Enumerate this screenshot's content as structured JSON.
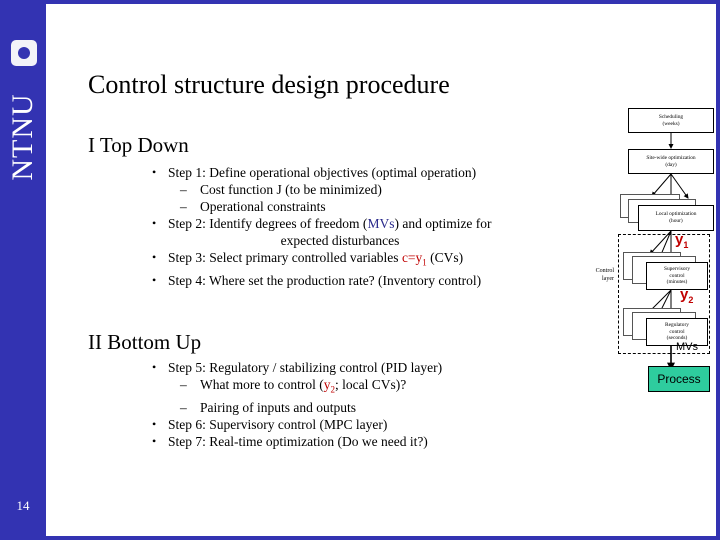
{
  "sidebar": {
    "brand": "NTNU",
    "logo_icon": "ntnu-square-dot-logo",
    "page_number": "14"
  },
  "slide": {
    "title": "Control structure design procedure",
    "accent_color": "#3333b2",
    "highlight_red": "#c00000",
    "highlight_blue": "#2a2a8c"
  },
  "sections": {
    "top_down": {
      "heading": "I  Top Down",
      "bullets": [
        {
          "level": 1,
          "prefix": "Step 1: Define operational objectives (optimal operation)"
        },
        {
          "level": 2,
          "prefix": "Cost function J (to be minimized)"
        },
        {
          "level": 2,
          "prefix": "Operational constraints"
        },
        {
          "level": 1,
          "prefix": "Step 2: Identify degrees of freedom (",
          "mark": "MVs",
          "mark_color": "blue",
          "suffix": ") and optimize for"
        },
        {
          "level": 1,
          "center": true,
          "prefix": "expected disturbances"
        },
        {
          "level": 1,
          "prefix": "Step 3: Select primary controlled variables ",
          "mark": "c=y",
          "mark_sub": "1",
          "mark_color": "red",
          "suffix": " (CVs)"
        },
        {
          "level": 1,
          "prefix": "Step 4: Where set the production rate? (Inventory control)"
        }
      ]
    },
    "bottom_up": {
      "heading": "II Bottom Up",
      "bullets": [
        {
          "level": 1,
          "prefix": "Step 5: Regulatory / stabilizing control (PID layer)"
        },
        {
          "level": 2,
          "prefix": "What more to control (",
          "mark": "y",
          "mark_sub": "2",
          "mark_color": "red",
          "suffix": "; local CVs)?"
        },
        {
          "level": 2,
          "prefix": "Pairing of inputs and outputs"
        },
        {
          "level": 1,
          "prefix": "Step 6: Supervisory control (MPC layer)"
        },
        {
          "level": 1,
          "prefix": "Step 7: Real-time optimization (Do we need it?)"
        }
      ]
    }
  },
  "diagram": {
    "boxes": [
      {
        "line1": "Scheduling",
        "line2": "(weeks)"
      },
      {
        "line1": "Site-wide optimization",
        "line2": "(day)"
      },
      {
        "line1": "Local optimization",
        "line2": "(hour)"
      },
      {
        "line1": "Supervisory",
        "line2": "control",
        "line3": "(minutes)"
      },
      {
        "line1": "Regulatory",
        "line2": "control",
        "line3": "(seconds)"
      }
    ],
    "control_layer_label_line1": "Control",
    "control_layer_label_line2": "layer",
    "y1_label": "y",
    "y1_sub": "1",
    "y2_label": "y",
    "y2_sub": "2",
    "mvs_label": "MVs",
    "process_label": "Process",
    "process_color": "#2ecc9e"
  }
}
